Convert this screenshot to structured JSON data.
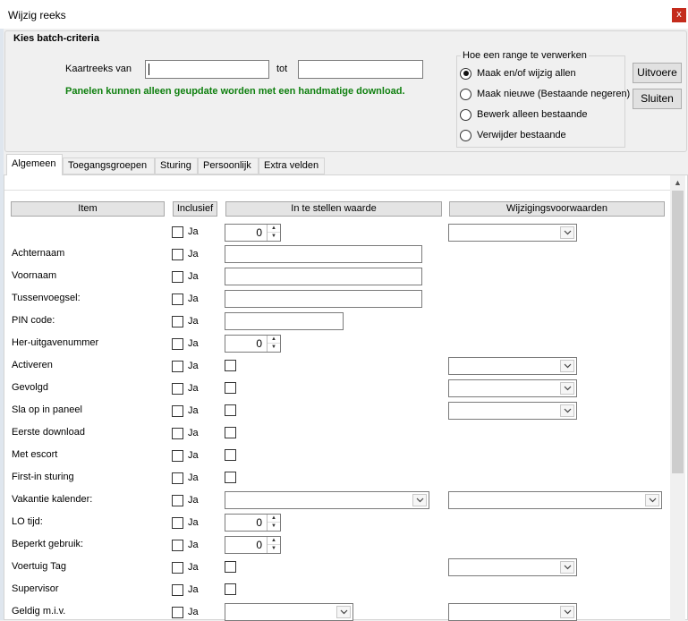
{
  "window": {
    "title": "Wijzig reeks",
    "close_glyph": "x"
  },
  "criteria": {
    "legend": "Kies batch-criteria",
    "from_label": "Kaartreeks van",
    "from_value": "",
    "to_label": "tot",
    "to_value": "",
    "warning": "Panelen kunnen alleen geupdate worden met een handmatige download.",
    "warning_color": "#108010"
  },
  "range_group": {
    "title": "Hoe een range te verwerken",
    "options": [
      {
        "label": "Maak en/of wijzig allen",
        "selected": true
      },
      {
        "label": "Maak nieuwe (Bestaande negeren)",
        "selected": false
      },
      {
        "label": "Bewerk alleen bestaande",
        "selected": false
      },
      {
        "label": "Verwijder bestaande",
        "selected": false
      }
    ]
  },
  "buttons": {
    "execute": "Uitvoere",
    "close": "Sluiten"
  },
  "tabs": [
    {
      "label": "Algemeen",
      "active": true
    },
    {
      "label": "Toegangsgroepen",
      "active": false
    },
    {
      "label": "Sturing",
      "active": false
    },
    {
      "label": "Persoonlijk",
      "active": false
    },
    {
      "label": "Extra velden",
      "active": false
    }
  ],
  "grid": {
    "headers": {
      "item": "Item",
      "inclusive": "Inclusief",
      "value": "In te stellen waarde",
      "conditions": "Wijzigingsvoorwaarden"
    },
    "ja_label": "Ja",
    "rows": [
      {
        "label": "",
        "included": false,
        "value": "0"
      },
      {
        "label": "Achternaam",
        "included": false,
        "value": ""
      },
      {
        "label": "Voornaam",
        "included": false,
        "value": ""
      },
      {
        "label": "Tussenvoegsel:",
        "included": false,
        "value": ""
      },
      {
        "label": "PIN code:",
        "included": false,
        "value": ""
      },
      {
        "label": "Her-uitgavenummer",
        "included": false,
        "value": "0"
      },
      {
        "label": "Activeren",
        "included": false,
        "checked": false
      },
      {
        "label": "Gevolgd",
        "included": false,
        "checked": false
      },
      {
        "label": "Sla op in paneel",
        "included": false,
        "checked": false
      },
      {
        "label": "Eerste download",
        "included": false,
        "checked": false
      },
      {
        "label": "Met escort",
        "included": false,
        "checked": false
      },
      {
        "label": "First-in sturing",
        "included": false,
        "checked": false
      },
      {
        "label": "Vakantie kalender:",
        "included": false,
        "value": ""
      },
      {
        "label": "LO tijd:",
        "included": false,
        "value": "0"
      },
      {
        "label": "Beperkt gebruik:",
        "included": false,
        "value": "0"
      },
      {
        "label": "Voertuig Tag",
        "included": false,
        "checked": false
      },
      {
        "label": "Supervisor",
        "included": false,
        "checked": false
      },
      {
        "label": "Geldig m.i.v.",
        "included": false,
        "value": ""
      }
    ]
  }
}
